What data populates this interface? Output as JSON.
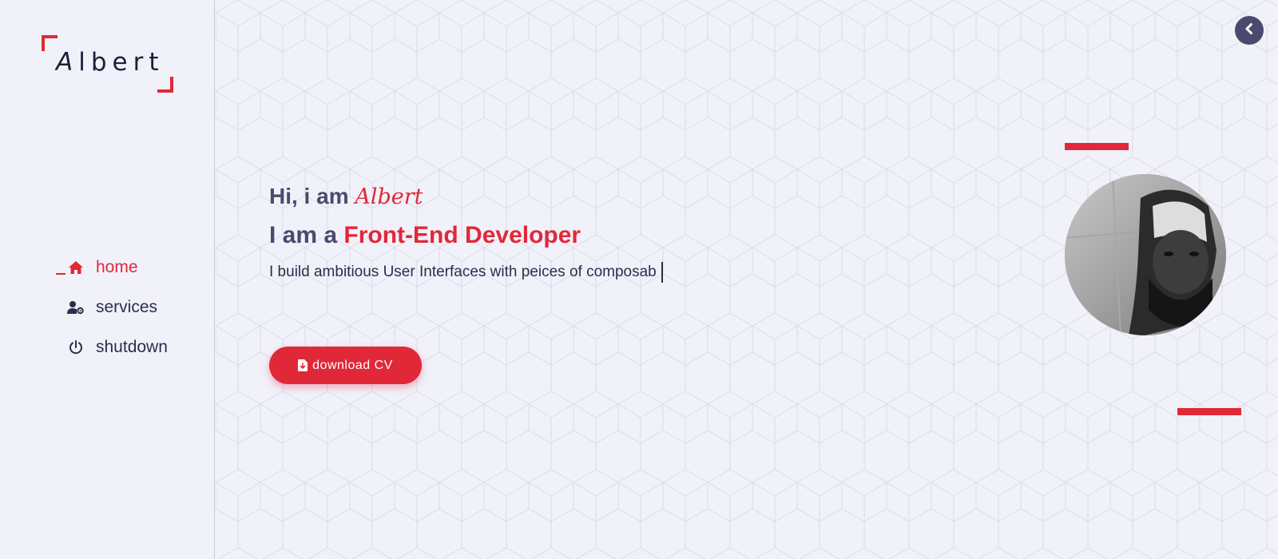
{
  "logo": {
    "first_letter": "A",
    "rest": "lbert"
  },
  "nav": {
    "items": [
      {
        "label": "home",
        "icon": "home-icon",
        "active": true
      },
      {
        "label": "services",
        "icon": "user-gear-icon",
        "active": false
      },
      {
        "label": "shutdown",
        "icon": "power-icon",
        "active": false
      }
    ]
  },
  "hero": {
    "greeting_prefix": "Hi, i am",
    "greeting_name": "Albert",
    "role_prefix": "I am a",
    "role_title": "Front-End Developer",
    "tagline": "I build ambitious User Interfaces with peices of composab"
  },
  "cta": {
    "download_label": "download CV"
  },
  "colors": {
    "accent": "#e12838",
    "text_dark": "#2d2d4a",
    "text_muted": "#4a4a6e",
    "background": "#f1f1fa"
  },
  "icons": {
    "collapse": "chevron-left-icon",
    "download": "file-download-icon"
  }
}
